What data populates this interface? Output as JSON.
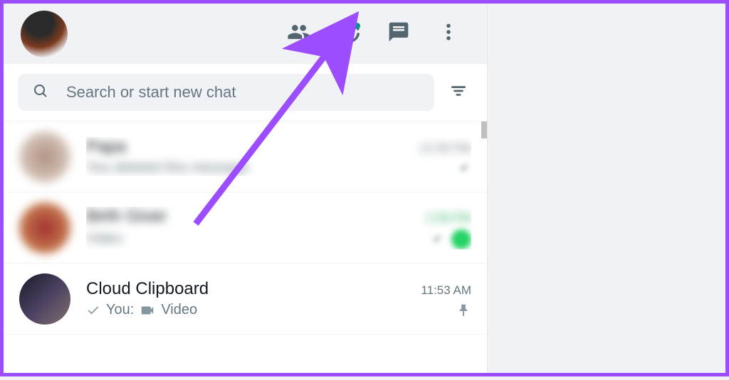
{
  "header": {
    "icons": {
      "communities": "communities-icon",
      "status": "status-icon",
      "new_chat": "new-chat-icon",
      "menu": "menu-icon"
    },
    "status_has_update": true
  },
  "search": {
    "placeholder": "Search or start new chat"
  },
  "chats": [
    {
      "name": "Papa",
      "preview_prefix": "",
      "preview": "You deleted this message",
      "time": "12:30 PM",
      "pinned": true,
      "unread": false,
      "blurred": true,
      "time_green": false
    },
    {
      "name": "Birth Giver",
      "preview_prefix": "",
      "preview": "Video",
      "time": "2:39 PM",
      "pinned": true,
      "unread": true,
      "blurred": true,
      "time_green": true
    },
    {
      "name": "Cloud Clipboard",
      "preview_prefix": "You:",
      "preview": "Video",
      "time": "11:53 AM",
      "pinned": true,
      "unread": false,
      "blurred": false,
      "time_green": false
    }
  ],
  "annotation": {
    "arrow_color": "#9c4dff"
  }
}
